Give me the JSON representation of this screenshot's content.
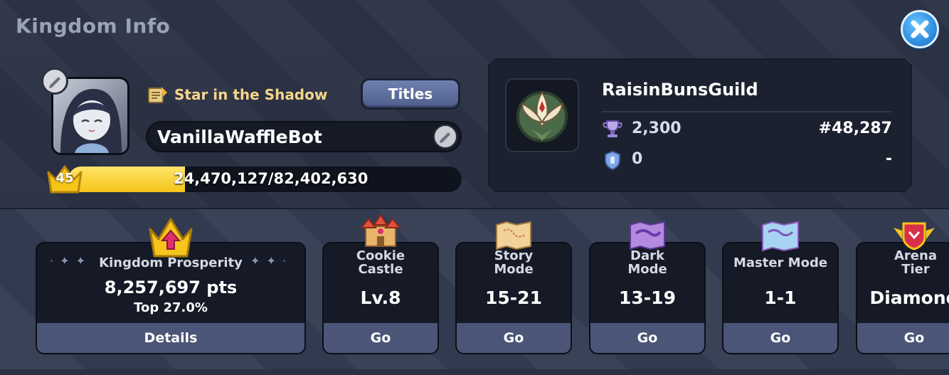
{
  "header": {
    "title": "Kingdom Info",
    "close_icon": "close-icon"
  },
  "profile": {
    "title_text": "Star in the Shadow",
    "titles_button": "Titles",
    "player_name": "VanillaWaffleBot",
    "level": "45",
    "xp_text": "24,470,127/82,402,630",
    "xp_fraction": 0.297
  },
  "guild": {
    "name": "RaisinBunsGuild",
    "trophies": "2,300",
    "rank": "#48,287",
    "secondary_value": "0",
    "secondary_rank": "-"
  },
  "cards": {
    "prosperity": {
      "label": "Kingdom Prosperity",
      "points": "8,257,697 pts",
      "top": "Top 27.0%",
      "button": "Details"
    },
    "castle": {
      "label_line1": "Cookie",
      "label_line2": "Castle",
      "value": "Lv.8",
      "button": "Go"
    },
    "story": {
      "label_line1": "Story",
      "label_line2": "Mode",
      "value": "15-21",
      "button": "Go"
    },
    "dark": {
      "label_line1": "Dark",
      "label_line2": "Mode",
      "value": "13-19",
      "button": "Go"
    },
    "master": {
      "label": "Master Mode",
      "value": "1-1",
      "button": "Go"
    },
    "arena": {
      "label_line1": "Arena",
      "label_line2": "Tier",
      "value": "Diamond",
      "button": "Go"
    }
  },
  "colors": {
    "accent_gold": "#f5c518",
    "button_blue": "#4a5577",
    "close_blue": "#2f8fe0"
  }
}
